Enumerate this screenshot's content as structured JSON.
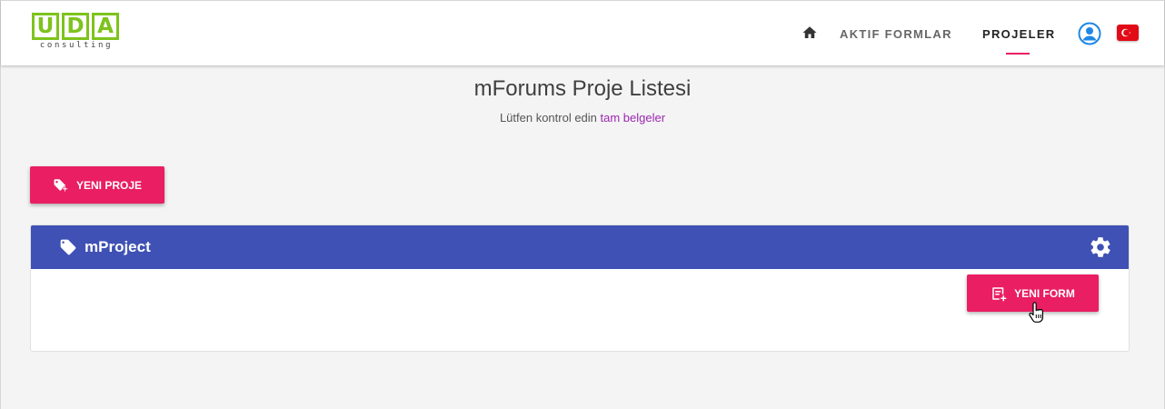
{
  "header": {
    "logo": {
      "letters": [
        "U",
        "D",
        "A"
      ],
      "subtitle": "consulting",
      "color": "#7ec31d"
    },
    "nav": {
      "home_icon": "home-icon",
      "items": [
        {
          "label": "AKTIF FORMLAR",
          "active": false
        },
        {
          "label": "PROJELER",
          "active": true
        }
      ],
      "user_icon": "user-circle-icon",
      "language_icon": "turkey-flag-icon"
    },
    "accent_color": "#e91e63"
  },
  "page": {
    "title": "mForums Proje Listesi",
    "subtitle_prefix": "Lütfen kontrol edin ",
    "subtitle_link": "tam belgeler"
  },
  "actions": {
    "new_project_label": "YENI PROJE",
    "new_project_icon": "tag-plus-icon"
  },
  "projects": [
    {
      "name": "mProject",
      "header_color": "#3f51b5",
      "tag_icon": "tag-icon",
      "settings_icon": "gear-icon",
      "new_form_label": "YENI FORM",
      "new_form_icon": "form-add-icon"
    }
  ]
}
